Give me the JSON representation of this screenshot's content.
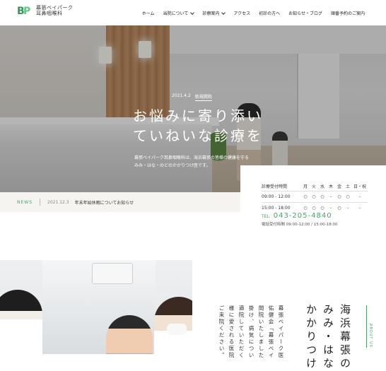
{
  "header": {
    "logo_line1": "幕張ベイパーク",
    "logo_line2": "耳鼻咽喉科",
    "nav": [
      {
        "label": "ホーム"
      },
      {
        "label": "当院について"
      },
      {
        "label": "診療案内"
      },
      {
        "label": "アクセス"
      },
      {
        "label": "初診の方へ"
      },
      {
        "label": "お知らせ・ブログ"
      },
      {
        "label": "順番予約のご案内"
      }
    ]
  },
  "hero": {
    "date": "2021.4.2",
    "tag": "新規開院",
    "title_line1": "お悩みに寄り添い",
    "title_line2": "ていねいな診療を",
    "desc_line1": "幕張ベイパーク耳鼻咽喉科は、海浜幕張の皆様の健康を守る",
    "desc_line2": "みみ・はな・のどのかかりつけ医です。"
  },
  "news": {
    "label": "NEWS",
    "date": "2021.12.3",
    "title": "年末年始休暇についてお知らせ"
  },
  "hours": {
    "header_label": "診療受付時間",
    "days": [
      "月",
      "火",
      "水",
      "木",
      "金",
      "土",
      "日・祝"
    ],
    "rows": [
      {
        "time": "09:00 - 12:00",
        "marks": [
          "○",
          "○",
          "○",
          "-",
          "○",
          "○",
          "-"
        ]
      },
      {
        "time": "15:00 - 18:00",
        "marks": [
          "○",
          "○",
          "○",
          "-",
          "○",
          "-",
          "-"
        ]
      }
    ],
    "tel_prefix": "TEL.",
    "tel": "043-205-4840",
    "tel_hours": "電話受付時間 09:00-12:00 / 15:00-18:00"
  },
  "about": {
    "label": "ABOUT US",
    "heading": [
      "海浜幕張の",
      "みみ・はな",
      "かかりつけ"
    ],
    "body": [
      "幕張ベイパーク医",
      "佑健会「幕張ベイ",
      "開院いたしました",
      "掛け、病気につい",
      "適院していただく",
      "様に愛される医院",
      "ご来院ください。"
    ]
  }
}
